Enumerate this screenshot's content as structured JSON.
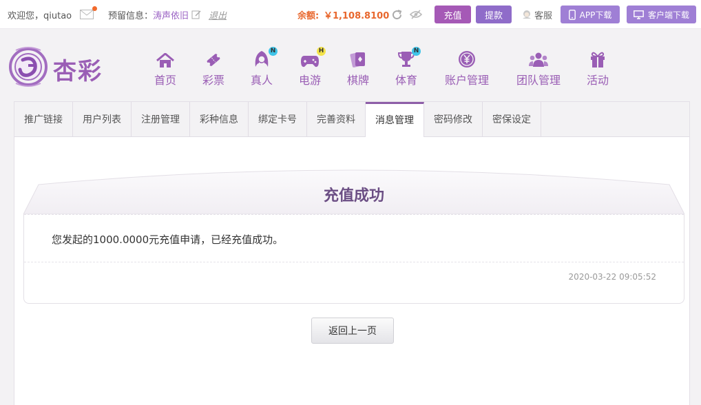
{
  "topbar": {
    "welcome": "欢迎您，qiutao",
    "reserve_label": "预留信息：",
    "reserve_value": "涛声依旧",
    "logout": "退出",
    "balance_label": "余额:",
    "balance_value": "￥1,108.8100",
    "recharge": "充值",
    "withdraw": "提款",
    "service": "客服",
    "app_download": "APP下载",
    "client_download": "客户端下载"
  },
  "logo": {
    "text": "杏彩"
  },
  "nav": [
    {
      "label": "首页",
      "icon": "home-icon",
      "badge": ""
    },
    {
      "label": "彩票",
      "icon": "ticket-icon",
      "badge": ""
    },
    {
      "label": "真人",
      "icon": "woman-icon",
      "badge": "N"
    },
    {
      "label": "电游",
      "icon": "gamepad-icon",
      "badge": "H"
    },
    {
      "label": "棋牌",
      "icon": "cards-icon",
      "badge": ""
    },
    {
      "label": "体育",
      "icon": "trophy-icon",
      "badge": "N"
    },
    {
      "label": "账户管理",
      "icon": "yen-coin-icon",
      "badge": ""
    },
    {
      "label": "团队管理",
      "icon": "team-icon",
      "badge": ""
    },
    {
      "label": "活动",
      "icon": "gift-icon",
      "badge": ""
    }
  ],
  "tabs": [
    {
      "label": "推广链接"
    },
    {
      "label": "用户列表"
    },
    {
      "label": "注册管理"
    },
    {
      "label": "彩种信息"
    },
    {
      "label": "绑定卡号"
    },
    {
      "label": "完善资料"
    },
    {
      "label": "消息管理",
      "active": true
    },
    {
      "label": "密码修改"
    },
    {
      "label": "密保设定"
    }
  ],
  "message": {
    "title": "充值成功",
    "body": "您发起的1000.0000元充值申请，已经充值成功。",
    "time": "2020-03-22 09:05:52"
  },
  "back_button": "返回上一页",
  "colors": {
    "accent": "#9a5eb5",
    "balance": "#e8672d",
    "recharge_btn": "#a559b6",
    "withdraw_btn": "#8f6cc9",
    "download_btn": "#9f7fd5"
  }
}
